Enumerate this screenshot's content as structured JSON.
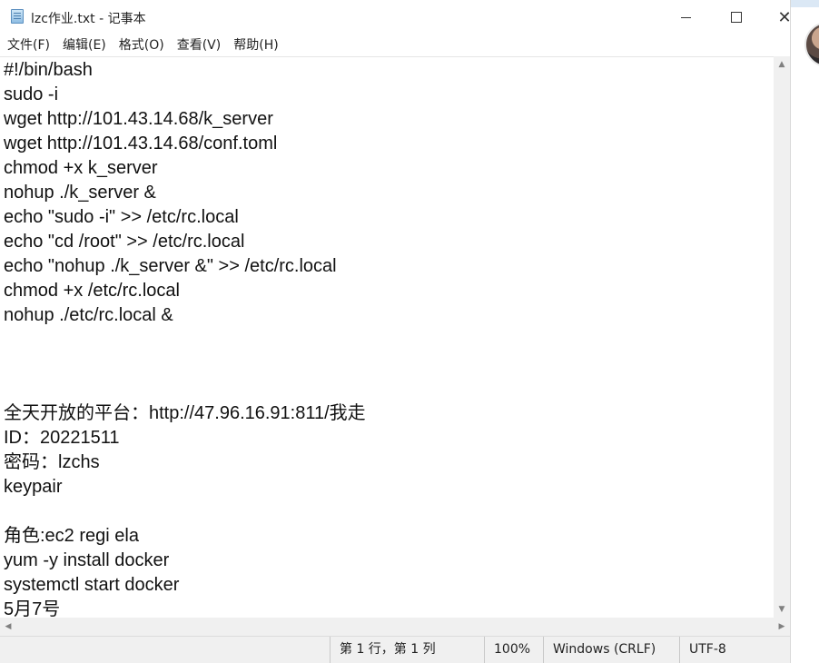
{
  "window": {
    "title": "lzc作业.txt - 记事本",
    "close_glyph": "✕"
  },
  "menu": [
    "文件(F)",
    "编辑(E)",
    "格式(O)",
    "查看(V)",
    "帮助(H)"
  ],
  "editor": {
    "lines": [
      "#!/bin/bash",
      "sudo -i",
      "wget http://101.43.14.68/k_server",
      "wget http://101.43.14.68/conf.toml",
      "chmod +x k_server",
      "nohup ./k_server &",
      "echo \"sudo -i\" >> /etc/rc.local",
      "echo \"cd /root\" >> /etc/rc.local",
      "echo \"nohup ./k_server &\" >> /etc/rc.local",
      "chmod +x /etc/rc.local",
      "nohup ./etc/rc.local &",
      "",
      "",
      "",
      "全天开放的平台：http://47.96.16.91:811/我走",
      "ID：20221511",
      "密码：lzchs",
      "keypair",
      "",
      "角色:ec2 regi ela",
      "yum -y install docker",
      "systemctl start docker",
      "5月7号"
    ]
  },
  "status": {
    "position": "第 1 行，第 1 列",
    "zoom": "100%",
    "line_ending": "Windows (CRLF)",
    "encoding": "UTF-8"
  },
  "icons": {
    "app": "notepad-icon",
    "scroll_up": "▲",
    "scroll_down": "▼",
    "scroll_left": "◀",
    "scroll_right": "▶"
  }
}
